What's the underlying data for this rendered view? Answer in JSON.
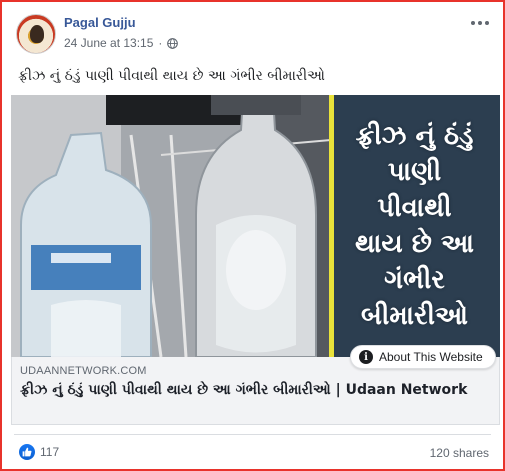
{
  "post": {
    "page_name": "Pagal Gujju",
    "timestamp": "24 June at 13:15",
    "separator": "·",
    "privacy_icon": "globe-icon",
    "text": "ફ્રીઝ નું ઠંડું પાણી પીવાથી થાય છે આ ગંભીર બીમારીઓ"
  },
  "image": {
    "overlay_lines": [
      "ફ્રીઝ નું ઠંડું",
      "પાણી",
      "પીવાથી",
      "થાય છે આ",
      "ગંભીર",
      "બીમારીઓ"
    ],
    "panel_color": "#2c3e50",
    "accent_color": "#e9e23a"
  },
  "about_button": {
    "label": "About This Website",
    "icon": "info-icon"
  },
  "link": {
    "domain": "UDAANNETWORK.COM",
    "title": "ફ્રીઝ નું ઠંડું પાણી પીવાથી થાય છે આ ગંભીર બીમારીઓ | Udaan Network"
  },
  "footer": {
    "reaction_icon": "like-icon",
    "reaction_count": "117",
    "shares": "120 shares"
  },
  "colors": {
    "border": "#e8332b",
    "page_name": "#385898",
    "like": "#1877f2"
  }
}
